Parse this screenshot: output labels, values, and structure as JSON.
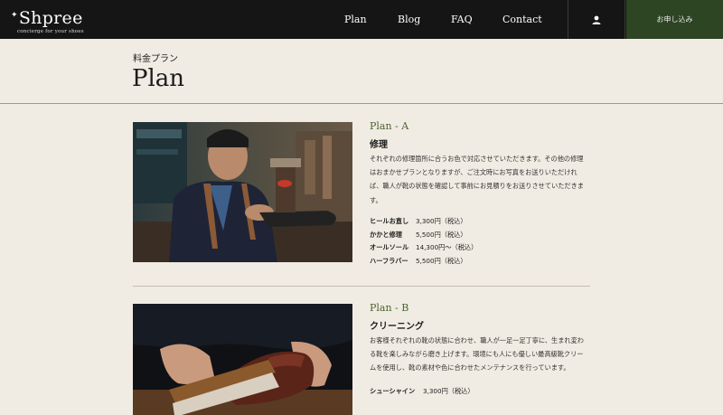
{
  "header": {
    "logo_text": "Shpree",
    "logo_tagline": "concierge for your shoes",
    "nav": [
      "Plan",
      "Blog",
      "FAQ",
      "Contact"
    ],
    "user_icon": "user-icon",
    "apply_label": "お申し込み"
  },
  "page": {
    "subtitle": "料金プラン",
    "title": "Plan"
  },
  "plans": [
    {
      "name": "Plan - A",
      "kind": "修理",
      "description_lines": [
        "それぞれの修理箇所に合うお色で対応させていただきます。その他の修理",
        "はおまかせプランとなりますが、ご注文時にお写真をお送りいただけれ",
        "ば、職人が靴の状態を確認して事前にお見積りをお送りさせていただきま",
        "す。"
      ],
      "prices": [
        {
          "name": "ヒールお直し",
          "price": "3,300円（税込）"
        },
        {
          "name": "かかと修理",
          "price": "5,500円（税込）"
        },
        {
          "name": "オールソール",
          "price": "14,300円〜（税込）"
        },
        {
          "name": "ハーフラバー",
          "price": "5,500円（税込）"
        }
      ]
    },
    {
      "name": "Plan - B",
      "kind": "クリーニング",
      "description_lines": [
        "お客様それぞれの靴の状態に合わせ、職人が一足一足丁寧に、生まれ変わ",
        "る靴を楽しみながら磨き上げます。環境にも人にも優しい最高級靴クリー",
        "ムを使用し、靴の素材や色に合わせたメンテナンスを行っています。"
      ],
      "prices": [
        {
          "name": "シューシャイン",
          "price": "3,300円（税込）"
        }
      ]
    }
  ],
  "colors": {
    "header_bg": "#151515",
    "apply_bg": "#2d4523",
    "page_bg": "#f1ece3",
    "plan_name": "#4a6430"
  }
}
